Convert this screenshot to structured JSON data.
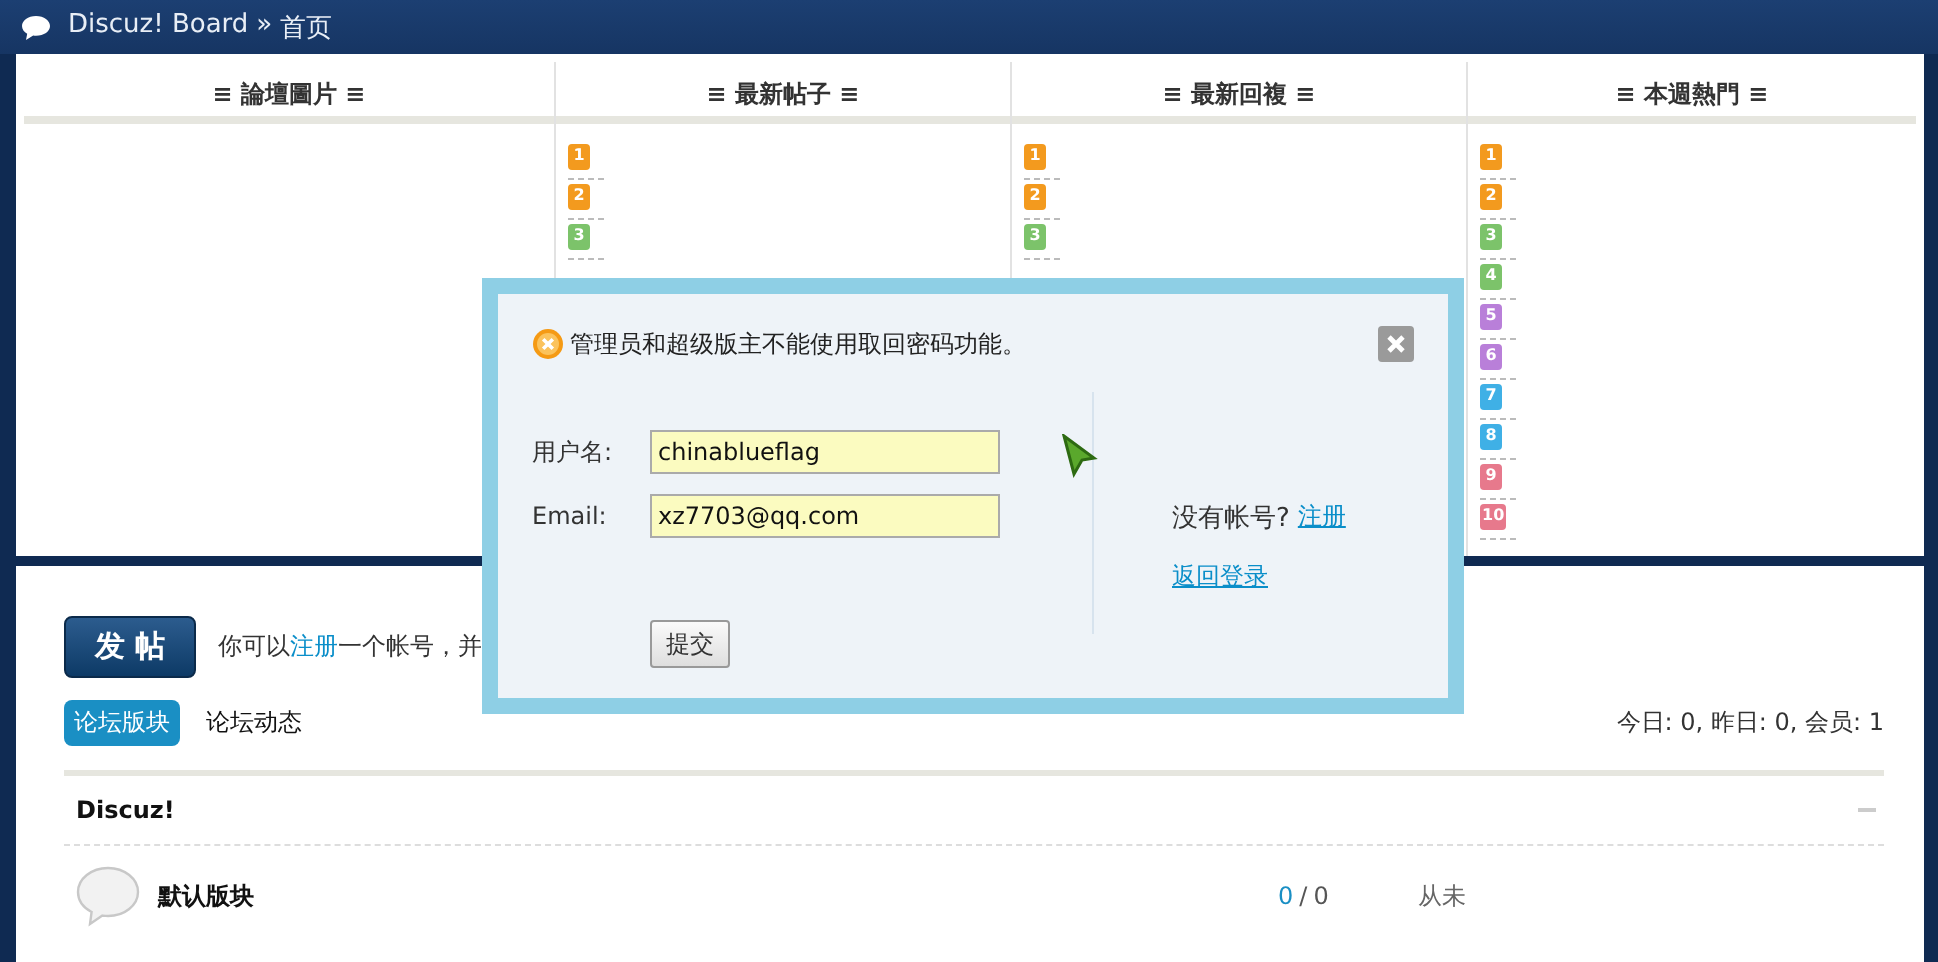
{
  "breadcrumb": [
    "Discuz! Board",
    "»",
    "首页"
  ],
  "columns": [
    {
      "title": "≡ 論壇圖片 ≡"
    },
    {
      "title": "≡ 最新帖子 ≡",
      "ranks": [
        {
          "label": "1",
          "color": "#f39a1e"
        },
        {
          "label": "2",
          "color": "#f39a1e"
        },
        {
          "label": "3",
          "color": "#7cc36a"
        }
      ]
    },
    {
      "title": "≡ 最新回複 ≡",
      "ranks": [
        {
          "label": "1",
          "color": "#f39a1e"
        },
        {
          "label": "2",
          "color": "#f39a1e"
        },
        {
          "label": "3",
          "color": "#7cc36a"
        }
      ]
    },
    {
      "title": "≡ 本週熱門 ≡",
      "ranks": [
        {
          "label": "1",
          "color": "#f39a1e"
        },
        {
          "label": "2",
          "color": "#f39a1e"
        },
        {
          "label": "3",
          "color": "#7cc36a"
        },
        {
          "label": "4",
          "color": "#7cc36a"
        },
        {
          "label": "5",
          "color": "#b97fd9"
        },
        {
          "label": "6",
          "color": "#b97fd9"
        },
        {
          "label": "7",
          "color": "#3fb0e6"
        },
        {
          "label": "8",
          "color": "#3fb0e6"
        },
        {
          "label": "9",
          "color": "#e7798c"
        },
        {
          "label": "10",
          "color": "#e7798c"
        }
      ]
    }
  ],
  "post_button": "发 帖",
  "notice": {
    "before": "你可以",
    "link": "注册",
    "after": "一个帐号，并"
  },
  "tabs": [
    {
      "label": "论坛版块",
      "selected": true
    },
    {
      "label": "论坛动态",
      "selected": false
    }
  ],
  "stats": "今日: 0, 昨日: 0, 会员: 1",
  "category": {
    "title": "Discuz!",
    "collapsed": false,
    "forums": [
      {
        "name": "默认版块",
        "threads": "0",
        "separator": "/",
        "posts": "0",
        "last_post": "从未"
      }
    ]
  },
  "dialog": {
    "message": "管理员和超级版主不能使用取回密码功能。",
    "fields": [
      {
        "label": "用户名:",
        "value": "chinablueflag"
      },
      {
        "label": "Email:",
        "value": "xz7703@qq.com"
      }
    ],
    "submit": "提交",
    "no_account": "没有帐号?",
    "register_link": "注册",
    "back_link": "返回登录"
  }
}
